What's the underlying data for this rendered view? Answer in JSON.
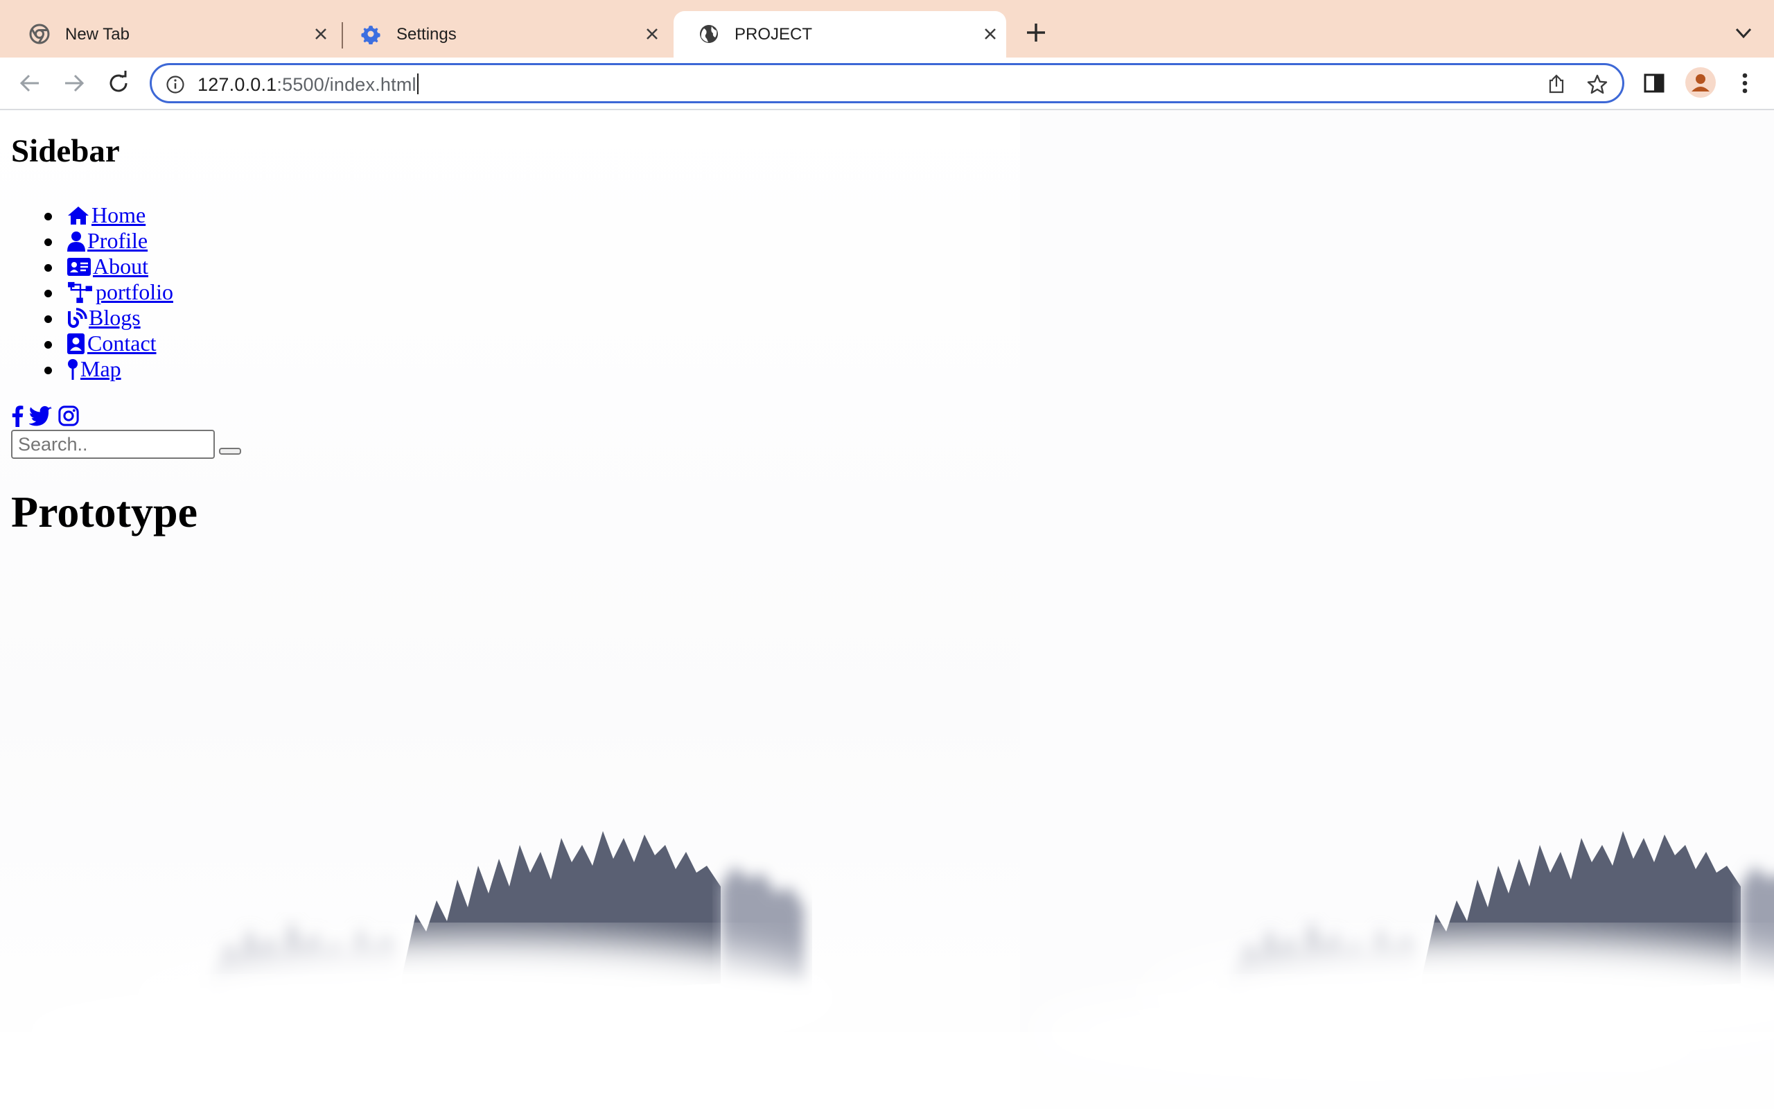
{
  "browser": {
    "tabs": [
      {
        "title": "New Tab",
        "icon": "chrome-icon",
        "active": false
      },
      {
        "title": "Settings",
        "icon": "gear-icon",
        "active": false
      },
      {
        "title": "PROJECT",
        "icon": "globe-icon",
        "active": true
      }
    ],
    "url_host": "127.0.0.1",
    "url_path": ":5500/index.html",
    "colors": {
      "tabstrip": "#f8dccb",
      "omnibox_border": "#3d68d6",
      "link": "#0000ee"
    }
  },
  "page": {
    "sidebar_heading": "Sidebar",
    "nav": [
      {
        "label": "Home",
        "icon": "home-icon"
      },
      {
        "label": "Profile",
        "icon": "user-icon"
      },
      {
        "label": "About",
        "icon": "id-card-icon"
      },
      {
        "label": "portfolio",
        "icon": "sitemap-icon"
      },
      {
        "label": "Blogs",
        "icon": "blog-icon"
      },
      {
        "label": "Contact",
        "icon": "contact-book-icon"
      },
      {
        "label": "Map",
        "icon": "map-pin-icon"
      }
    ],
    "social": [
      "facebook-icon",
      "twitter-icon",
      "instagram-icon"
    ],
    "search_placeholder": "Search..",
    "title": "Prototype"
  }
}
